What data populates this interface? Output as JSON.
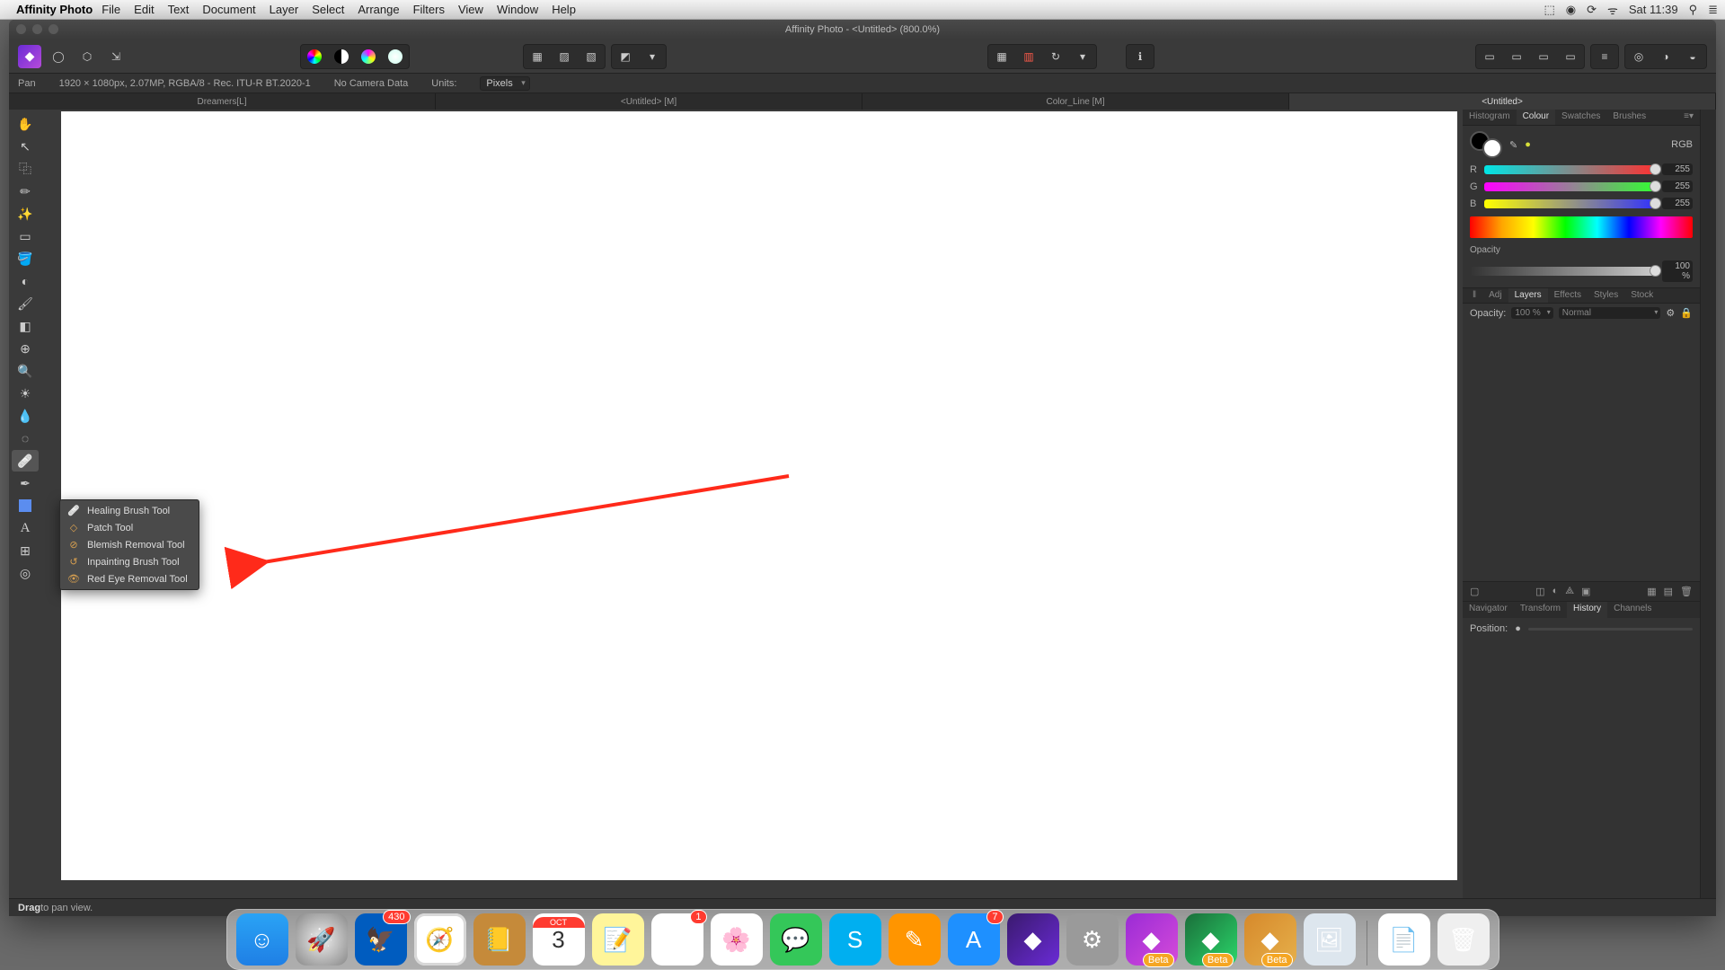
{
  "mac": {
    "app_name": "Affinity Photo",
    "menus": [
      "File",
      "Edit",
      "Text",
      "Document",
      "Layer",
      "Select",
      "Arrange",
      "Filters",
      "View",
      "Window",
      "Help"
    ],
    "status_icons": [
      "dropbox-icon",
      "cloud-icon",
      "sync-icon",
      "wifi-icon"
    ],
    "clock": "Sat 11:39",
    "search_icon": "⚲",
    "menu_icon": "≣"
  },
  "window": {
    "title": "Affinity Photo - <Untitled> (800.0%)"
  },
  "context": {
    "tool_name": "Pan",
    "doc_info": "1920 × 1080px, 2.07MP, RGBA/8 - Rec. ITU-R BT.2020-1",
    "camera": "No Camera Data",
    "units_label": "Units:",
    "units_value": "Pixels"
  },
  "doc_tabs": [
    "Dreamers[L]",
    "<Untitled> [M]",
    "Color_Line [M]",
    "<Untitled>"
  ],
  "doc_tabs_active": 3,
  "tools": [
    {
      "name": "hand-tool",
      "glyph": "✋"
    },
    {
      "name": "move-tool",
      "glyph": "↖"
    },
    {
      "name": "crop-tool",
      "glyph": "⿻"
    },
    {
      "name": "selection-brush-tool",
      "glyph": "✏"
    },
    {
      "name": "magic-wand-tool",
      "glyph": "✨"
    },
    {
      "name": "marquee-tool",
      "glyph": "▭"
    },
    {
      "name": "flood-fill-tool",
      "glyph": "🪣"
    },
    {
      "name": "gradient-tool",
      "glyph": "◐"
    },
    {
      "name": "paint-brush-tool",
      "glyph": "🖌"
    },
    {
      "name": "erase-tool",
      "glyph": "◧"
    },
    {
      "name": "clone-tool",
      "glyph": "⊕"
    },
    {
      "name": "zoom-tool",
      "glyph": "🔍"
    },
    {
      "name": "dodge-burn-tool",
      "glyph": "☀"
    },
    {
      "name": "smudge-tool",
      "glyph": "💧"
    },
    {
      "name": "blur-tool",
      "glyph": "◌"
    },
    {
      "name": "healing-tool",
      "glyph": "🩹"
    },
    {
      "name": "pen-tool",
      "glyph": "✒"
    },
    {
      "name": "shape-tool",
      "glyph": "■"
    },
    {
      "name": "text-tool",
      "glyph": "A"
    },
    {
      "name": "mesh-tool",
      "glyph": "⊞"
    },
    {
      "name": "view-tool",
      "glyph": "◎"
    }
  ],
  "flyout": {
    "items": [
      {
        "icon": "🩹",
        "label": "Healing Brush Tool"
      },
      {
        "icon": "◇",
        "label": "Patch Tool"
      },
      {
        "icon": "⊘",
        "label": "Blemish Removal Tool"
      },
      {
        "icon": "↺",
        "label": "Inpainting Brush Tool"
      },
      {
        "icon": "👁",
        "label": "Red Eye Removal Tool"
      }
    ]
  },
  "panels": {
    "top_tabs": [
      "Histogram",
      "Colour",
      "Swatches",
      "Brushes"
    ],
    "top_active": 1,
    "color_mode": "RGB",
    "r": "255",
    "g": "255",
    "b": "255",
    "opacity_label": "Opacity",
    "opacity_value": "100 %",
    "mid_tabs": [
      "Adj",
      "Layers",
      "Effects",
      "Styles",
      "Stock"
    ],
    "mid_active": 1,
    "opacity_field_label": "Opacity:",
    "opacity_field_value": "100 %",
    "blend_value": "Normal",
    "bottom_tabs": [
      "Navigator",
      "Transform",
      "History",
      "Channels"
    ],
    "bottom_active": 2,
    "position_label": "Position:"
  },
  "status": {
    "hint_bold": "Drag",
    "hint_rest": " to pan view."
  },
  "dock": {
    "mail_badge": "430",
    "reminders_badge": "1",
    "appstore_badge": "7",
    "cal_month": "OCT",
    "cal_day": "3",
    "beta": "Beta"
  }
}
